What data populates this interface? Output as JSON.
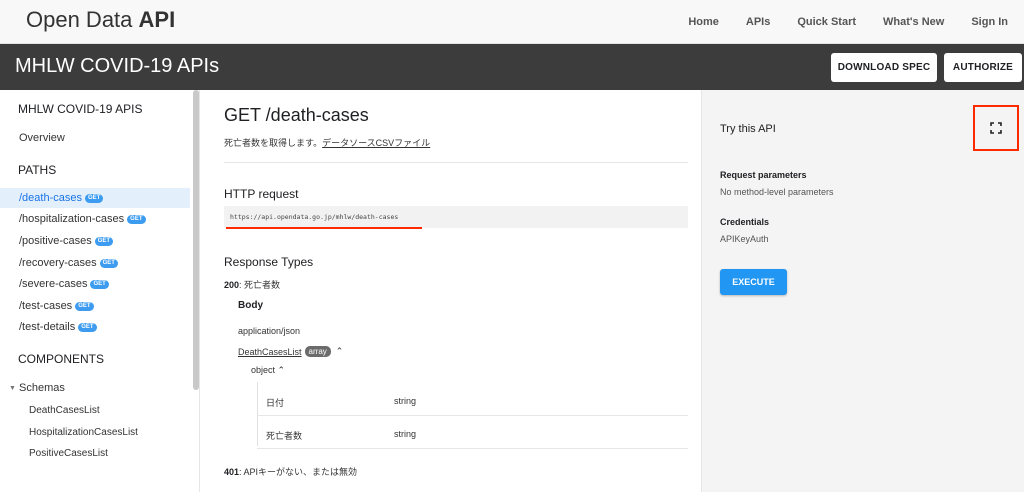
{
  "brand": {
    "plain": "Open Data ",
    "bold": "API"
  },
  "topnav": [
    "Home",
    "APIs",
    "Quick Start",
    "What's New",
    "Sign In"
  ],
  "titlebar": {
    "title": "MHLW COVID-19 APIs",
    "download_label": "DOWNLOAD SPEC",
    "authorize_label": "AUTHORIZE"
  },
  "sidebar": {
    "heading": "MHLW COVID-19 APIS",
    "overview": "Overview",
    "paths_heading": "PATHS",
    "paths": [
      {
        "label": "/death-cases",
        "badge": "GET",
        "active": true
      },
      {
        "label": "/hospitalization-cases",
        "badge": "GET"
      },
      {
        "label": "/positive-cases",
        "badge": "GET"
      },
      {
        "label": "/recovery-cases",
        "badge": "GET"
      },
      {
        "label": "/severe-cases",
        "badge": "GET"
      },
      {
        "label": "/test-cases",
        "badge": "GET"
      },
      {
        "label": "/test-details",
        "badge": "GET"
      }
    ],
    "components_heading": "COMPONENTS",
    "schemas_label": "Schemas",
    "schemas": [
      "DeathCasesList",
      "HospitalizationCasesList",
      "PositiveCasesList"
    ]
  },
  "main": {
    "title": "GET /death-cases",
    "description_text": "死亡者数を取得します。",
    "description_link": "データソースCSVファイル",
    "http_request_heading": "HTTP request",
    "url": "https://api.opendata.go.jp/mhlw/death-cases",
    "response_types_heading": "Response Types",
    "response_200_code": "200",
    "response_200_text": ": 死亡者数",
    "body_heading": "Body",
    "mime": "application/json",
    "schema_link": "DeathCasesList",
    "schema_badge": "array",
    "object_label": "object",
    "fields": [
      {
        "name": "日付",
        "type": "string"
      },
      {
        "name": "死亡者数",
        "type": "string"
      }
    ],
    "response_401_code": "401",
    "response_401_text": ": APIキーがない、または無効"
  },
  "right_panel": {
    "title": "Try this API",
    "request_params_label": "Request parameters",
    "request_params_value": "No method-level parameters",
    "credentials_label": "Credentials",
    "credentials_value": "APIKeyAuth",
    "execute_label": "EXECUTE"
  },
  "colors": {
    "accent_blue": "#2196f3",
    "highlight_red": "#ff2a00",
    "titlebar_bg": "#3c3c3c"
  }
}
